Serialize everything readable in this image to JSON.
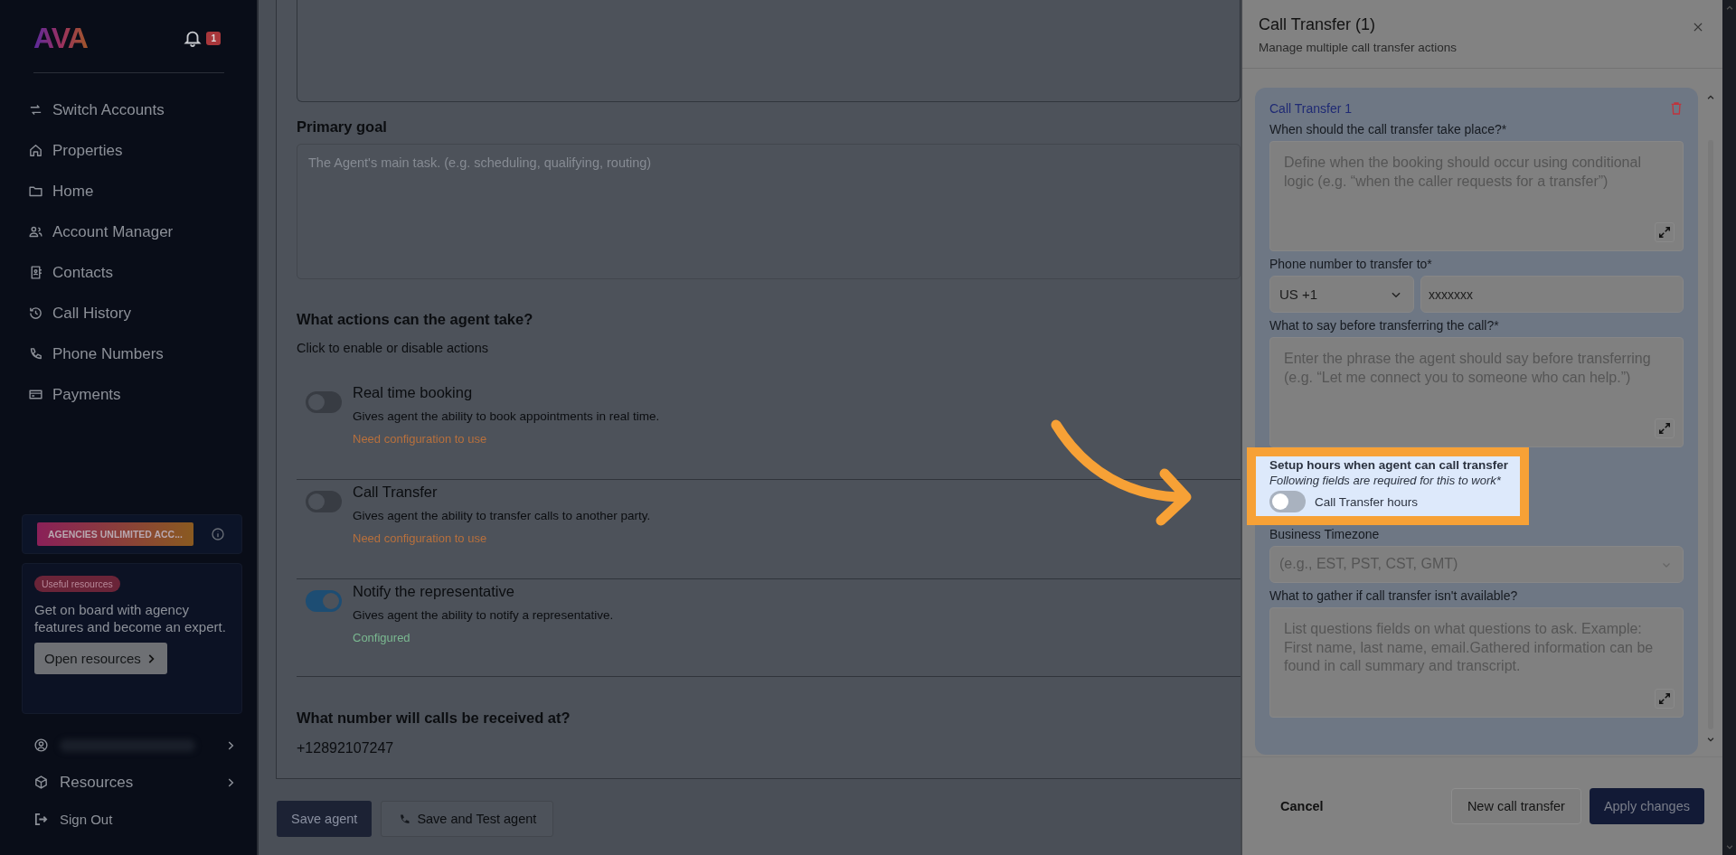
{
  "sidebar": {
    "logo": "AVA",
    "notifications": "1",
    "nav": [
      {
        "label": "Switch Accounts"
      },
      {
        "label": "Properties"
      },
      {
        "label": "Home"
      },
      {
        "label": "Account Manager"
      },
      {
        "label": "Contacts"
      },
      {
        "label": "Call History"
      },
      {
        "label": "Phone Numbers"
      },
      {
        "label": "Payments"
      }
    ],
    "plan": "AGENCIES UNLIMITED ACC...",
    "resources_card": {
      "tag": "Useful resources",
      "text": "Get on board with agency features and become an expert.",
      "button": "Open resources"
    },
    "bottom": [
      {
        "kind": "account"
      },
      {
        "kind": "link",
        "label": "Resources"
      },
      {
        "kind": "plain",
        "label": "Sign Out"
      }
    ]
  },
  "main": {
    "primary_goal": {
      "label": "Primary goal",
      "placeholder": "The Agent's main task. (e.g. scheduling, qualifying, routing)"
    },
    "actions_title": "What actions can the agent take?",
    "actions_subtitle": "Click to enable or disable actions",
    "actions": [
      {
        "name": "Real time booking",
        "description": "Gives agent the ability to book appointments in real time.",
        "status": "Need configuration to use",
        "kind": "warning",
        "on": false
      },
      {
        "name": "Call Transfer",
        "description": "Gives agent the ability to transfer calls to another party.",
        "status": "Need configuration to use",
        "kind": "warning",
        "on": false
      },
      {
        "name": "Notify the representative",
        "description": "Gives agent the ability to notify a representative.",
        "status": "Configured",
        "kind": "ok",
        "on": true
      }
    ],
    "number_label": "What number will calls be received at?",
    "number": "+12892107247",
    "buttons": [
      "Save agent",
      "Save and Test agent"
    ]
  },
  "panel": {
    "title": "Call Transfer (1)",
    "subtitle": "Manage multiple call transfer actions",
    "card": {
      "title": "Call Transfer 1",
      "when": {
        "label": "When should the call transfer take place?*",
        "placeholder": "Define when the booking should occur using conditional logic (e.g. “when the caller requests for a transfer”)"
      },
      "phone": {
        "label": "Phone number to transfer to*",
        "country": "US +1",
        "placeholder": "xxxxxxx"
      },
      "say": {
        "label": "What to say before transferring the call?*",
        "placeholder": "Enter the phrase the agent should say before transferring (e.g. “Let me connect you to someone who can help.”)"
      },
      "hours": {
        "title": "Setup hours when agent can call transfer",
        "note": "Following fields are required for this to work*",
        "toggle": "Call Transfer hours",
        "on": false,
        "highlighted": true
      },
      "timezone": {
        "label": "Business Timezone",
        "placeholder": "(e.g., EST, PST, CST, GMT)"
      },
      "gather": {
        "label": "What to gather if call transfer isn't available?",
        "placeholder": "List questions fields on what questions to ask. Example: First name, last name, email.Gathered information can be found in call summary and transcript."
      }
    },
    "buttons": [
      "Cancel",
      "New call transfer",
      "Apply changes"
    ]
  }
}
